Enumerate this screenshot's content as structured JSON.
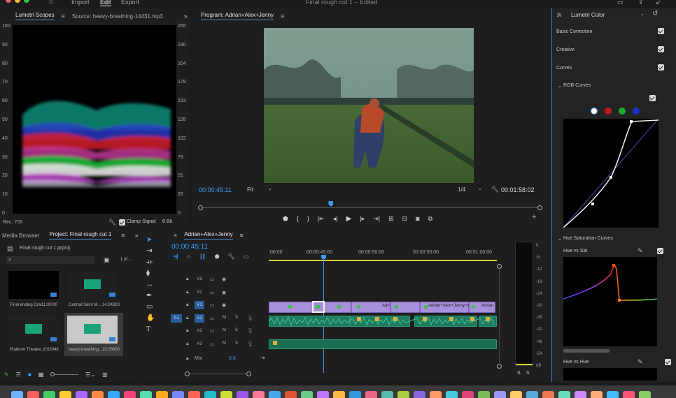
{
  "menubar": {
    "items": [
      "Import",
      "Edit",
      "Export"
    ],
    "active": "Edit",
    "title": "Final rough cut 1 – Edited"
  },
  "scopes": {
    "tab_label": "Lumetri Scopes",
    "source_label": "Source: heavy-breathing-14431.mp3",
    "left_axis": [
      "100",
      "90",
      "80",
      "70",
      "60",
      "50",
      "40",
      "30",
      "20",
      "10",
      "0"
    ],
    "right_axis": [
      "255",
      "230",
      "204",
      "178",
      "153",
      "128",
      "102",
      "76",
      "51",
      "26",
      "0"
    ],
    "standard": "Rec. 709",
    "clamp_label": "Clamp Signal",
    "bit_depth": "8 Bit"
  },
  "program": {
    "title": "Program: Adrian+Alex+Jenny",
    "timecode": "00:00:45:11",
    "fit": "Fit",
    "resolution": "1/4",
    "duration": "00:01:58:02",
    "playhead_fraction": 0.385
  },
  "lumetri": {
    "title": "Lumetri Color",
    "sections": [
      {
        "label": "Basic Correction",
        "checked": true
      },
      {
        "label": "Creative",
        "checked": true
      },
      {
        "label": "Curves",
        "checked": true
      }
    ],
    "rgb_curves": "RGB Curves",
    "channels": [
      {
        "name": "white",
        "color": "#ffffff"
      },
      {
        "name": "red",
        "color": "#c01818"
      },
      {
        "name": "green",
        "color": "#1fa82a"
      },
      {
        "name": "blue",
        "color": "#1c2fc6"
      }
    ],
    "hue_sat_curves": "Hue Saturation Curves",
    "hue_vs_sat": "Hue vs Sat",
    "hue_vs_hue": "Hue vs Hue"
  },
  "project": {
    "tab_media": "Media Browser",
    "tab_project": "Project: Final rough cut 1",
    "file": "Final rough cut 1.prproj",
    "count": "1 of ...",
    "items": [
      {
        "name": "Final ending Cred...",
        "duration": "1:00:00",
        "kind": "video"
      },
      {
        "name": "Central Saint M...",
        "duration": "14:24320",
        "kind": "audio"
      },
      {
        "name": "Platform Theatre...",
        "duration": "8:02048",
        "kind": "audio"
      },
      {
        "name": "heavy-breathing...",
        "duration": "10:26600",
        "kind": "audio"
      }
    ]
  },
  "timeline": {
    "sequence": "Adrian+Alex+Jenny",
    "timecode": "00:00:45:11",
    "ruler": [
      ":00:00",
      "00:00:45:00",
      "00:00:50:00",
      "00:00:55:00",
      "00:01:00:00"
    ],
    "video_tracks": [
      "V3",
      "V2",
      "V1"
    ],
    "audio_tracks": [
      "A1",
      "A2",
      "A3"
    ],
    "source_patch": "A1",
    "mix_label": "Mix",
    "mix_value": "0.0",
    "clip_labels": [
      "Adri",
      "Adrian+Alex+Jenny.m",
      "Adrian"
    ],
    "mute": "M",
    "solo": "S"
  },
  "meter": {
    "scale": [
      "0",
      "-6",
      "-12",
      "-18",
      "-24",
      "-30",
      "-36",
      "-42",
      "-48",
      "-54",
      "dB"
    ],
    "s1": "S",
    "s2": "S"
  }
}
